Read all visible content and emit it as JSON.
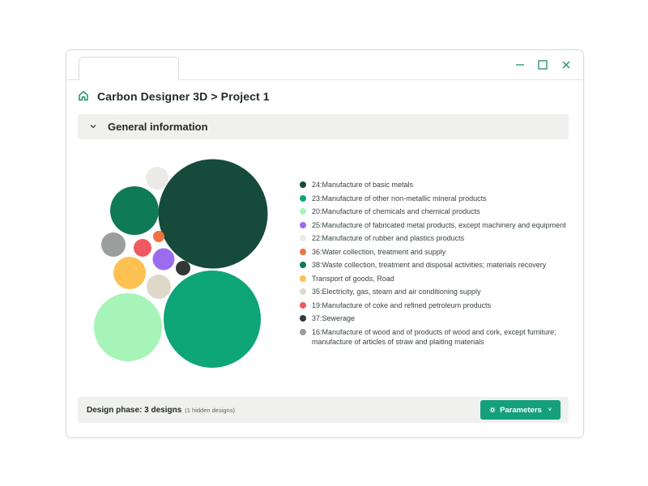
{
  "window": {
    "tab_label": "",
    "controls": [
      "minimize-icon",
      "maximize-icon",
      "close-icon"
    ]
  },
  "breadcrumb": {
    "icon": "home-icon",
    "text": "Carbon Designer 3D > Project 1"
  },
  "section": {
    "icon": "chevron-down-icon",
    "title": "General information"
  },
  "chart_data": {
    "type": "bubble",
    "series": [
      {
        "label": "24:Manufacture of basic metals",
        "color": "#164a3a"
      },
      {
        "label": "23:Manufacture of other non-metallic mineral products",
        "color": "#0ea577"
      },
      {
        "label": "20:Manufacture of chemicals and chemical products",
        "color": "#a6f4b8"
      },
      {
        "label": "25:Manufacture of fabricated metal products, except machinery and equipment",
        "color": "#9b6cf0"
      },
      {
        "label": "22:Manufacture of rubber and plastics products",
        "color": "#ebeae6"
      },
      {
        "label": "36:Water collection, treatment and supply",
        "color": "#ef7340"
      },
      {
        "label": "38:Waste collection, treatment and disposal activities; materials recovery",
        "color": "#0e7a56"
      },
      {
        "label": "Transport of goods, Road",
        "color": "#fdc153"
      },
      {
        "label": "35:Electricity, gas, steam and air conditioning supply",
        "color": "#dfd8c9"
      },
      {
        "label": "19:Manufacture of coke and refined petroleum products",
        "color": "#ef5a60"
      },
      {
        "label": "37:Sewerage",
        "color": "#333836"
      },
      {
        "label": "16:Manufacture of wood and of products of wood and cork, except furniture; manufacture of articles of straw and plaiting materials",
        "color": "#9a9e9d"
      }
    ]
  },
  "footer": {
    "phase_label": "Design phase: 3 designs",
    "hidden_note": "(1 hidden designs)",
    "button_label": "Parameters",
    "button_icon": "gear-icon",
    "button_caret": "˅",
    "button_color": "#14a07a"
  }
}
